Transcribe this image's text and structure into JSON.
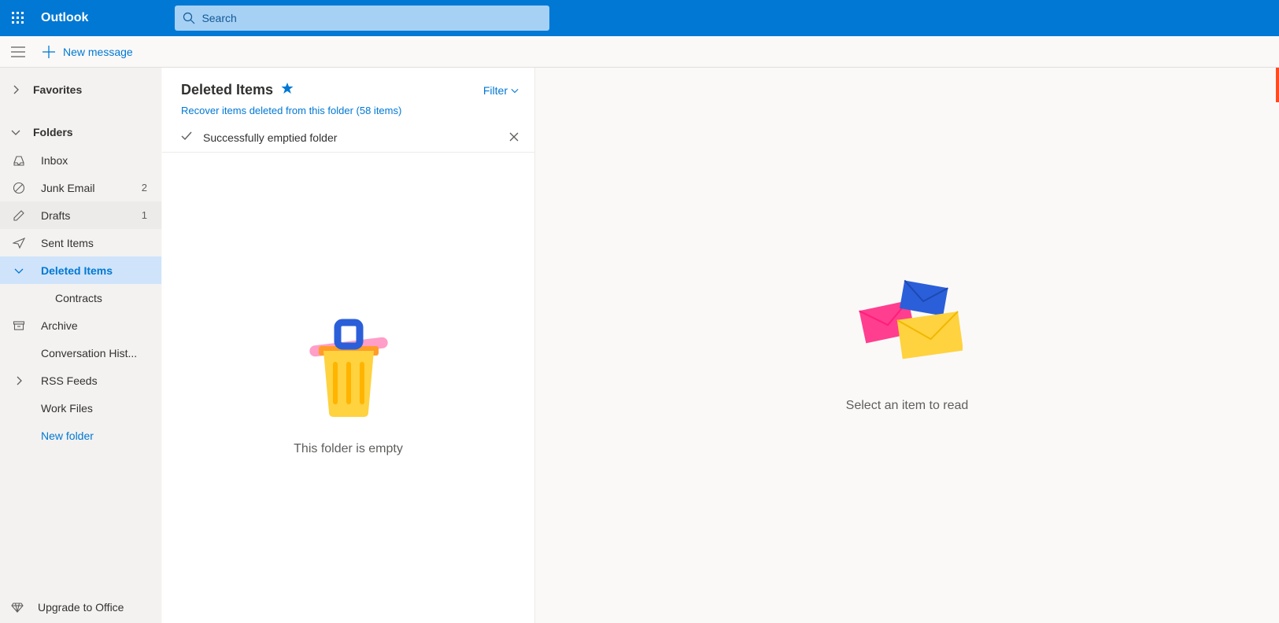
{
  "app": {
    "name": "Outlook"
  },
  "search": {
    "placeholder": "Search"
  },
  "toolbar": {
    "new_message": "New message"
  },
  "sidebar": {
    "favorites": "Favorites",
    "folders_label": "Folders",
    "folders": [
      {
        "label": "Inbox",
        "count": ""
      },
      {
        "label": "Junk Email",
        "count": "2"
      },
      {
        "label": "Drafts",
        "count": "1"
      },
      {
        "label": "Sent Items",
        "count": ""
      },
      {
        "label": "Deleted Items",
        "count": ""
      },
      {
        "label": "Contracts",
        "count": ""
      },
      {
        "label": "Archive",
        "count": ""
      },
      {
        "label": "Conversation Hist...",
        "count": ""
      },
      {
        "label": "RSS Feeds",
        "count": ""
      },
      {
        "label": "Work Files",
        "count": ""
      }
    ],
    "new_folder": "New folder",
    "upgrade": "Upgrade to Office"
  },
  "listpane": {
    "title": "Deleted Items",
    "filter": "Filter",
    "recover_link": "Recover items deleted from this folder (58 items)",
    "notification": "Successfully emptied folder",
    "empty": "This folder is empty"
  },
  "readpane": {
    "placeholder": "Select an item to read"
  }
}
